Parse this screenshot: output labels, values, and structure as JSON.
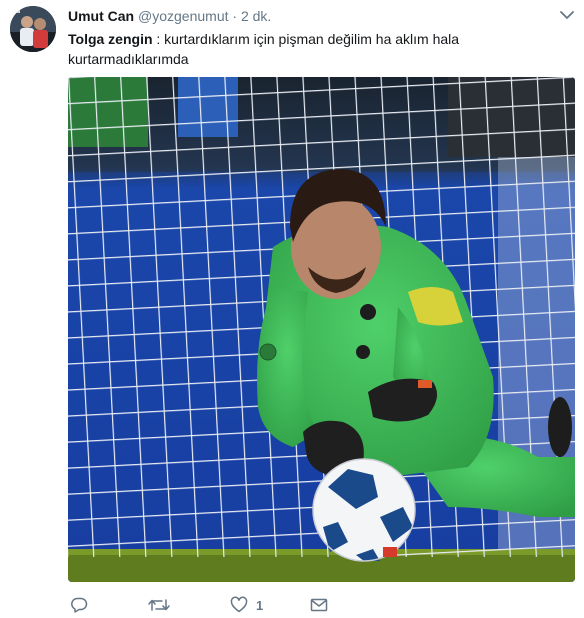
{
  "tweet": {
    "author_name": "Umut Can",
    "author_handle": "@yozgenumut",
    "separator": "·",
    "time": "2 dk.",
    "text_bold": "Tolga zengin",
    "text_rest": " : kurtardıklarım için pişman değilim ha aklım hala kurtarmadıklarımda",
    "like_count": "1"
  },
  "media": {
    "description_colors": {
      "net_background": "#1c46a8",
      "kit": "#3fbf5a",
      "pitch": "#5a7a1f"
    }
  },
  "icons": {
    "menu": "chevron-down-icon",
    "reply": "reply-icon",
    "retweet": "retweet-icon",
    "like": "heart-icon",
    "dm": "envelope-icon"
  },
  "colors": {
    "text_primary": "#14171a",
    "text_secondary": "#657786"
  }
}
